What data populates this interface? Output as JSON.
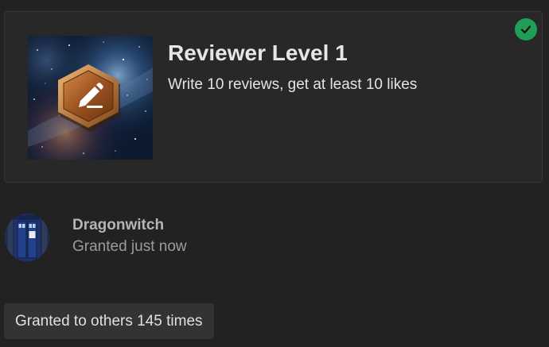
{
  "badge": {
    "title": "Reviewer Level 1",
    "description": "Write 10 reviews, get at least 10 likes",
    "image_icon": "pencil-icon",
    "status_icon": "check-icon",
    "status_color": "#1f9e55",
    "medal_color": "#8a4a1c"
  },
  "grant": {
    "username": "Dragonwitch",
    "granted_text": "Granted just now"
  },
  "footer": {
    "granted_count_label": "Granted to others 145 times"
  }
}
